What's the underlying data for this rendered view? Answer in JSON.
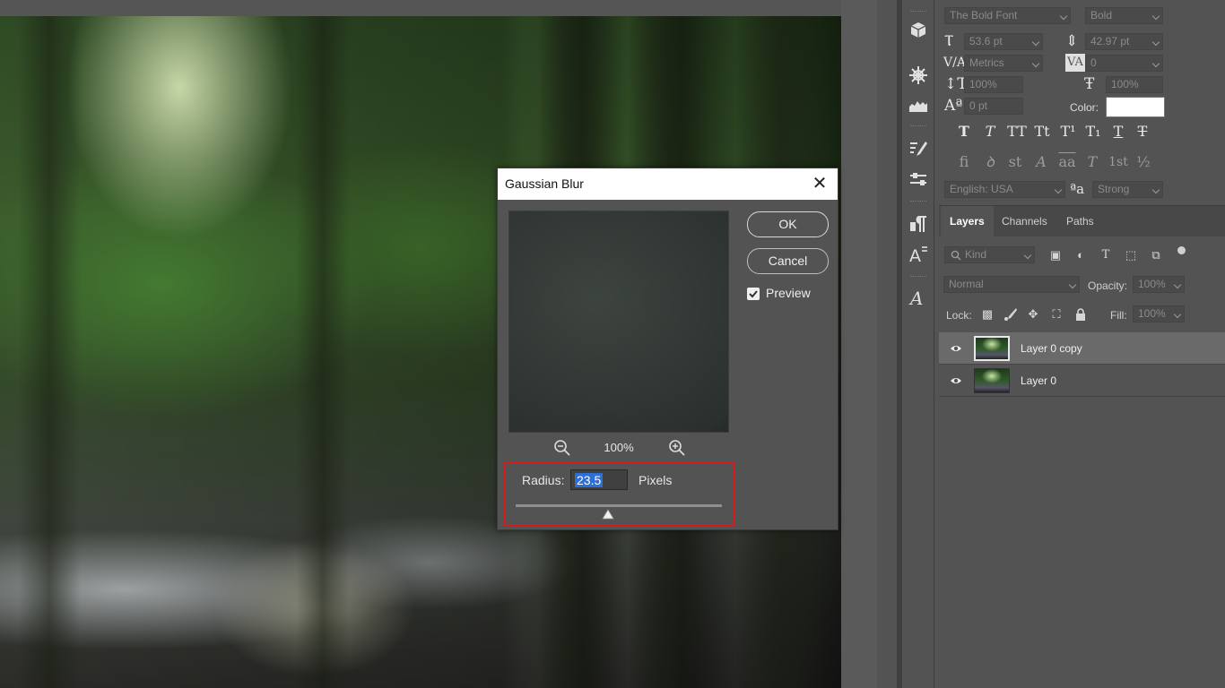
{
  "dialog": {
    "title": "Gaussian Blur",
    "ok_label": "OK",
    "cancel_label": "Cancel",
    "preview_label": "Preview",
    "preview_checked": true,
    "zoom_level": "100%",
    "radius_label": "Radius:",
    "radius_value": "23.5",
    "radius_unit": "Pixels"
  },
  "character_panel": {
    "font_family": "The Bold Font",
    "font_style": "Bold",
    "font_size": "53.6 pt",
    "leading": "42.97 pt",
    "kerning": "Metrics",
    "tracking": "0",
    "vertical_scale": "100%",
    "horizontal_scale": "100%",
    "baseline_shift": "0 pt",
    "color_label": "Color:",
    "color_value": "#ffffff",
    "language": "English: USA",
    "antialias": "Strong",
    "style_buttons": [
      "T",
      "T",
      "TT",
      "Tt",
      "T¹",
      "T₁",
      "T",
      "T"
    ],
    "opentype_buttons": [
      "fi",
      "ꝺ",
      "st",
      "A",
      "aa",
      "T",
      "1st",
      "½"
    ]
  },
  "layers_panel": {
    "tabs": [
      "Layers",
      "Channels",
      "Paths"
    ],
    "active_tab": "Layers",
    "filter_kind": "Kind",
    "blend_mode": "Normal",
    "opacity_label": "Opacity:",
    "opacity_value": "100%",
    "lock_label": "Lock:",
    "fill_label": "Fill:",
    "fill_value": "100%",
    "layers": [
      {
        "name": "Layer 0 copy",
        "selected": true,
        "visible": true
      },
      {
        "name": "Layer 0",
        "selected": false,
        "visible": true
      }
    ]
  },
  "colors": {
    "highlight_border": "#d41b1b",
    "selection_blue": "#2d6fd6",
    "panel_bg": "#535353"
  }
}
